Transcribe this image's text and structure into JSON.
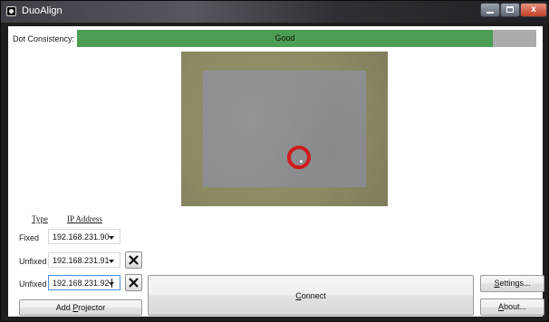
{
  "window": {
    "title": "DuoAlign",
    "close_glyph": "x"
  },
  "dot_consistency": {
    "label": "Dot Consistency:",
    "status": "Good",
    "level_fraction": 0.905,
    "fill_color": "#4c9e54",
    "track_color": "#ababab"
  },
  "preview": {
    "border_color": "#8c8a62",
    "inner_color": "#8d8e91",
    "target_ring_color": "#d01b1b"
  },
  "projectors": {
    "headers": {
      "type": "Type",
      "ip": "IP Address"
    },
    "rows": [
      {
        "type": "Fixed",
        "ip": "192.168.231.90"
      },
      {
        "type": "Unfixed",
        "ip": "192.168.231.91"
      },
      {
        "type": "Unfixed",
        "ip": "192.168.231.92"
      }
    ]
  },
  "buttons": {
    "add_projector_prefix": "Add ",
    "add_projector_underlined": "P",
    "add_projector_suffix": "rojector",
    "connect_prefix": "",
    "connect_underlined": "C",
    "connect_suffix": "onnect",
    "settings_prefix": "",
    "settings_underlined": "S",
    "settings_suffix": "ettings...",
    "about_prefix": "",
    "about_underlined": "A",
    "about_suffix": "bout..."
  }
}
